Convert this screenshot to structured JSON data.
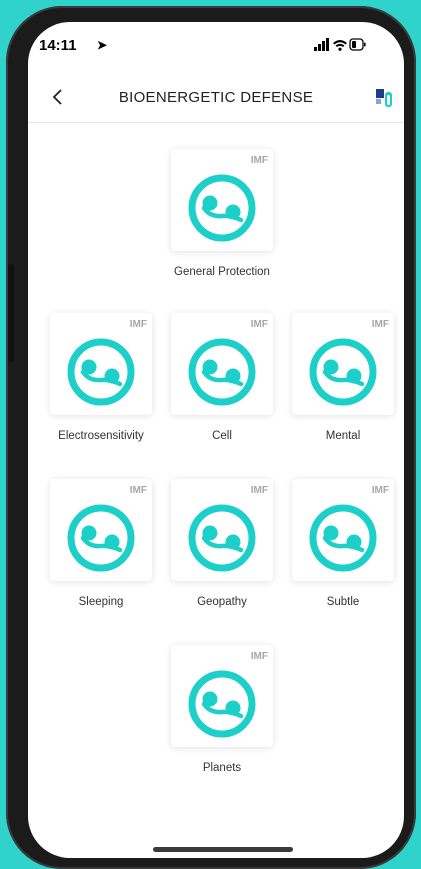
{
  "status": {
    "time": "14:11"
  },
  "header": {
    "title": "BIOENERGETIC DEFENSE"
  },
  "items": [
    {
      "label": "General Protection",
      "badge": "IMF"
    },
    {
      "label": "Electrosensitivity",
      "badge": "IMF"
    },
    {
      "label": "Cell",
      "badge": "IMF"
    },
    {
      "label": "Mental",
      "badge": "IMF"
    },
    {
      "label": "Sleeping",
      "badge": "IMF"
    },
    {
      "label": "Geopathy",
      "badge": "IMF"
    },
    {
      "label": "Subtle",
      "badge": "IMF"
    },
    {
      "label": "Planets",
      "badge": "IMF"
    }
  ],
  "colors": {
    "accent": "#1ccfc8",
    "frame_background": "#2fd3cb"
  }
}
